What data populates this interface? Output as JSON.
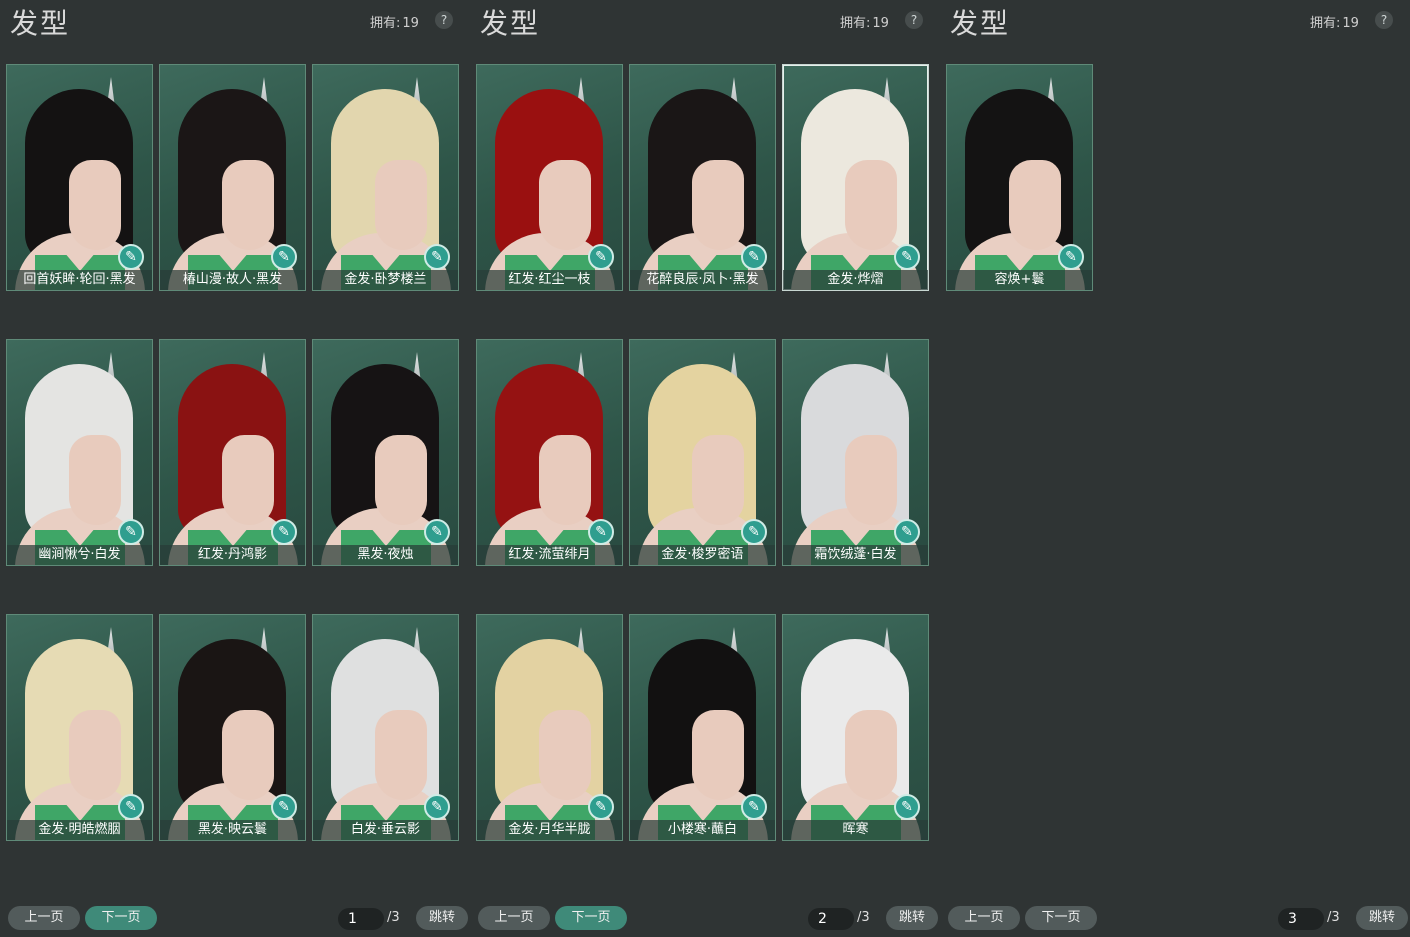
{
  "panels": [
    {
      "title": "发型",
      "owned_label": "拥有:",
      "owned_count": "19",
      "help": "?",
      "cards": [
        {
          "label": "回首妖眸·轮回·黑发",
          "hair": "#141212"
        },
        {
          "label": "椿山漫·故人·黑发",
          "hair": "#1b1616"
        },
        {
          "label": "金发·卧梦楼兰",
          "hair": "#e2d6ae"
        },
        {
          "label": "幽涧愀兮·白发",
          "hair": "#e4e4e2"
        },
        {
          "label": "红发·丹鸿影",
          "hair": "#8a1212"
        },
        {
          "label": "黑发·夜烛",
          "hair": "#161314"
        },
        {
          "label": "金发·明皓燃胭",
          "hair": "#e6dbb4"
        },
        {
          "label": "黑发·映云鬟",
          "hair": "#1a1514"
        },
        {
          "label": "白发·垂云影",
          "hair": "#dfe0e0"
        }
      ],
      "prev": "上一页",
      "next": "下一页",
      "page": "1",
      "total": "/3",
      "jump": "跳转"
    },
    {
      "title": "发型",
      "owned_label": "拥有:",
      "owned_count": "19",
      "help": "?",
      "cards": [
        {
          "label": "红发·红尘一枝",
          "hair": "#9a1010"
        },
        {
          "label": "花醉良辰·凤卜·黑发",
          "hair": "#1a1616"
        },
        {
          "label": "金发·烨熠",
          "hair": "#ece8de",
          "selected": true
        },
        {
          "label": "红发·流萤绯月",
          "hair": "#951212"
        },
        {
          "label": "金发·梭罗密语",
          "hair": "#e4d3a0"
        },
        {
          "label": "霜饮绒蓬·白发",
          "hair": "#d9dadc"
        },
        {
          "label": "金发·月华半胧",
          "hair": "#e3d2a2"
        },
        {
          "label": "小楼寒·蘸白",
          "hair": "#121111"
        },
        {
          "label": "晖寒",
          "hair": "#eaeaea"
        }
      ],
      "prev": "上一页",
      "next": "下一页",
      "page": "2",
      "total": "/3",
      "jump": "跳转"
    },
    {
      "title": "发型",
      "owned_label": "拥有:",
      "owned_count": "19",
      "help": "?",
      "cards": [
        {
          "label": "容焕+鬟",
          "hair": "#141313"
        }
      ],
      "prev": "上一页",
      "next": "下一页",
      "page": "3",
      "total": "/3",
      "jump": "跳转"
    }
  ],
  "colors": {
    "accent": "#3f8a79",
    "card_bg": "#2e5548",
    "page_bg": "#2f3434"
  },
  "icons": {
    "badge": "brush-icon",
    "help": "question-icon"
  }
}
